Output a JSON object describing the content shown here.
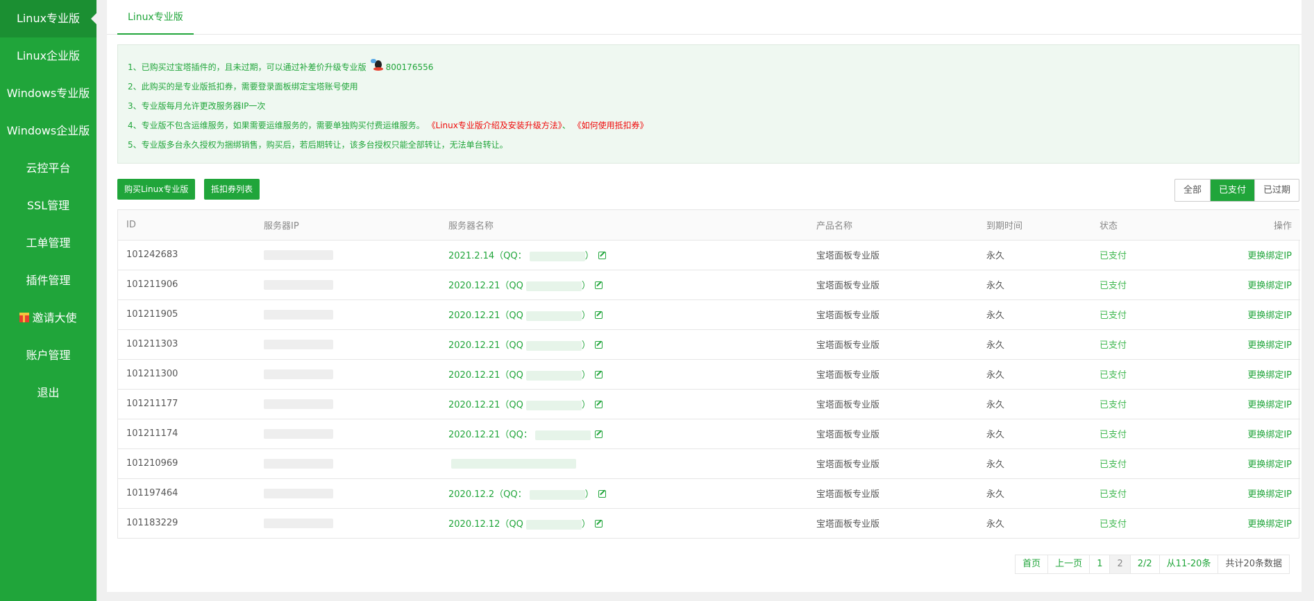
{
  "sidebar": {
    "items": [
      {
        "label": "Linux专业版"
      },
      {
        "label": "Linux企业版"
      },
      {
        "label": "Windows专业版"
      },
      {
        "label": "Windows企业版"
      },
      {
        "label": "云控平台"
      },
      {
        "label": "SSL管理"
      },
      {
        "label": "工单管理"
      },
      {
        "label": "插件管理"
      },
      {
        "label": "邀请大使"
      },
      {
        "label": "账户管理"
      },
      {
        "label": "退出"
      }
    ]
  },
  "tabs": [
    {
      "label": "Linux专业版"
    }
  ],
  "notice": {
    "line1": "1、已购买过宝塔插件的，且未过期，可以通过补差价升级专业版",
    "qq": "800176556",
    "line2": "2、此购买的是专业版抵扣券，需要登录面板绑定宝塔账号使用",
    "line3": "3、专业版每月允许更改服务器IP一次",
    "line4": "4、专业版不包含运维服务，如果需要运维服务的，需要单独购买付费运维服务。",
    "link1": "《Linux专业版介绍及安装升级方法》",
    "sep": "、",
    "link2": "《如何使用抵扣券》",
    "line5": "5、专业版多台永久授权为捆绑销售，购买后，若后期转让，该多台授权只能全部转让，无法单台转让。"
  },
  "toolbar": {
    "buy_label": "购买Linux专业版",
    "coupon_label": "抵扣券列表"
  },
  "filter": {
    "all": "全部",
    "paid": "已支付",
    "expired": "已过期"
  },
  "table": {
    "headers": {
      "id": "ID",
      "ip": "服务器IP",
      "name": "服务器名称",
      "product": "产品名称",
      "expire": "到期时间",
      "status": "状态",
      "action": "操作"
    },
    "rows": [
      {
        "id": "101242683",
        "name": "2021.2.14（QQ：",
        "close": "）",
        "product": "宝塔面板专业版",
        "expire": "永久",
        "status": "已支付",
        "action": "更换绑定IP"
      },
      {
        "id": "101211906",
        "name": "2020.12.21（QQ",
        "close": "）",
        "product": "宝塔面板专业版",
        "expire": "永久",
        "status": "已支付",
        "action": "更换绑定IP"
      },
      {
        "id": "101211905",
        "name": "2020.12.21（QQ",
        "close": "）",
        "product": "宝塔面板专业版",
        "expire": "永久",
        "status": "已支付",
        "action": "更换绑定IP"
      },
      {
        "id": "101211303",
        "name": "2020.12.21（QQ",
        "close": "）",
        "product": "宝塔面板专业版",
        "expire": "永久",
        "status": "已支付",
        "action": "更换绑定IP"
      },
      {
        "id": "101211300",
        "name": "2020.12.21（QQ",
        "close": "）",
        "product": "宝塔面板专业版",
        "expire": "永久",
        "status": "已支付",
        "action": "更换绑定IP"
      },
      {
        "id": "101211177",
        "name": "2020.12.21（QQ",
        "close": "）",
        "product": "宝塔面板专业版",
        "expire": "永久",
        "status": "已支付",
        "action": "更换绑定IP"
      },
      {
        "id": "101211174",
        "name": "2020.12.21（QQ：",
        "close": "",
        "product": "宝塔面板专业版",
        "expire": "永久",
        "status": "已支付",
        "action": "更换绑定IP"
      },
      {
        "id": "101210969",
        "name": "",
        "close": "",
        "product": "宝塔面板专业版",
        "expire": "永久",
        "status": "已支付",
        "action": "更换绑定IP"
      },
      {
        "id": "101197464",
        "name": "2020.12.2（QQ：",
        "close": "）",
        "product": "宝塔面板专业版",
        "expire": "永久",
        "status": "已支付",
        "action": "更换绑定IP"
      },
      {
        "id": "101183229",
        "name": "2020.12.12（QQ",
        "close": "）",
        "product": "宝塔面板专业版",
        "expire": "永久",
        "status": "已支付",
        "action": "更换绑定IP"
      }
    ]
  },
  "pagination": {
    "first": "首页",
    "prev": "上一页",
    "p1": "1",
    "p2": "2",
    "total_pages": "2/2",
    "range": "从11-20条",
    "total": "共计20条数据"
  },
  "colors": {
    "brand": "#20a53a",
    "sidebar_active": "#1b8f32",
    "link_red": "#ef0808"
  }
}
